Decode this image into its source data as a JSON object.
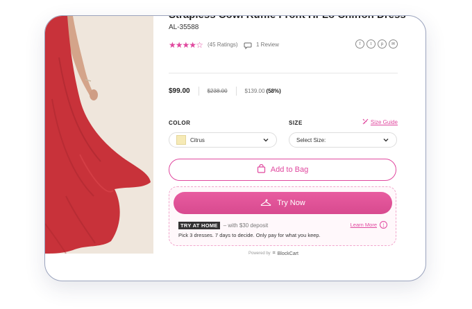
{
  "product": {
    "title": "Strapless Cowl Ruffle Front Hi-Lo Chiffon Dress",
    "sku": "AL-35588",
    "rating_stars": 4,
    "ratings_count_label": "(45 Ratings)",
    "review_count_label": "1 Review"
  },
  "share": {
    "icons": [
      "facebook-icon",
      "twitter-icon",
      "pinterest-icon",
      "email-icon"
    ]
  },
  "price": {
    "current": "$99.00",
    "was": "$238.00",
    "sale": "$139.00",
    "discount": "(58%)"
  },
  "color": {
    "label": "COLOR",
    "selected": "Citrus",
    "swatch": "#f6eab6"
  },
  "size": {
    "label": "SIZE",
    "placeholder": "Select Size:",
    "guide_label": "Size Guide"
  },
  "actions": {
    "add_to_bag": "Add to Bag",
    "try_now": "Try Now"
  },
  "try_at_home": {
    "badge": "TRY AT HOME",
    "deposit_text": "– with $30 deposit",
    "learn_more": "Learn More",
    "description": "Pick 3 dresses. 7 days to decide. Only pay for what you keep."
  },
  "footer": {
    "powered_by": "Powered by",
    "brand": "BlockCart"
  },
  "colors": {
    "accent": "#e0479e",
    "dress": "#c8323a"
  }
}
